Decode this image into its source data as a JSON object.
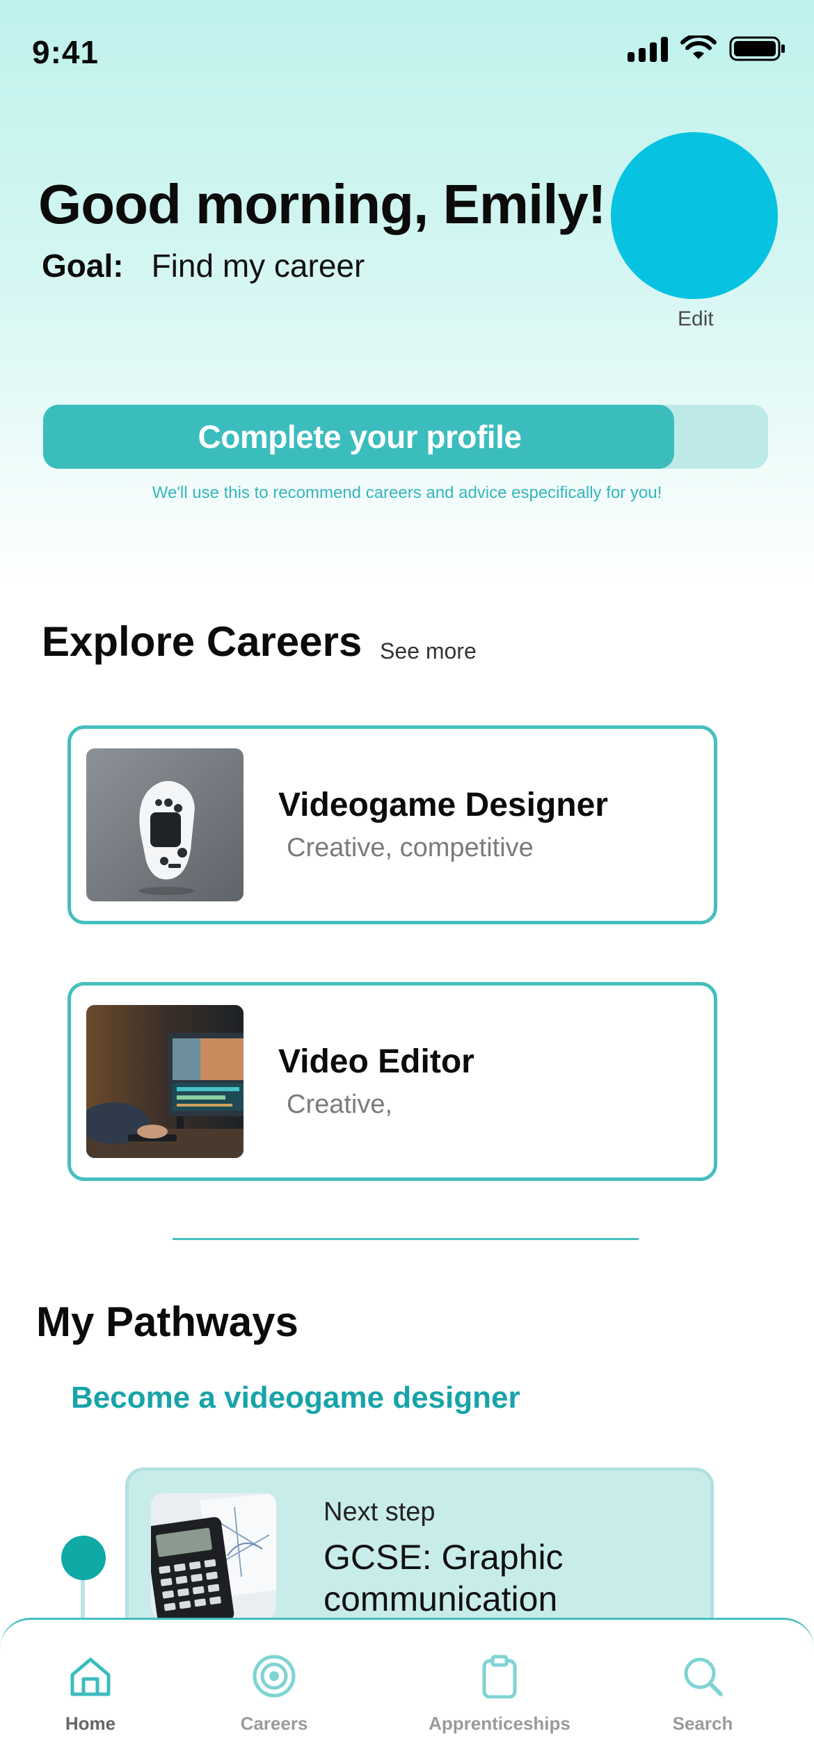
{
  "status_bar": {
    "time": "9:41"
  },
  "header": {
    "greeting": "Good morning, Emily!",
    "goal_label": "Goal:",
    "goal_value": "Find my career",
    "edit_label": "Edit",
    "avatar_color": "#08c2e1"
  },
  "profile": {
    "cta_label": "Complete your profile",
    "note": "We'll use this to recommend careers and advice especifically for you!",
    "completion_fraction": 0.87
  },
  "explore": {
    "title": "Explore Careers",
    "see_more": "See more",
    "careers": [
      {
        "title": "Videogame Designer",
        "tags": "Creative, competitive",
        "image": "game-controller"
      },
      {
        "title": "Video Editor",
        "tags": "Creative,",
        "image": "editing-workstation"
      }
    ]
  },
  "pathways": {
    "title": "My Pathways",
    "pathway_name": "Become a videogame designer",
    "next_step_label": "Next step",
    "next_step_title": "GCSE: Graphic communication",
    "next_step_image": "calculator-and-drawings"
  },
  "bottom_nav": {
    "items": [
      {
        "label": "Home",
        "icon": "home-icon",
        "active": true
      },
      {
        "label": "Careers",
        "icon": "target-icon",
        "active": false
      },
      {
        "label": "Apprenticeships",
        "icon": "clipboard-icon",
        "active": false
      },
      {
        "label": "Search",
        "icon": "search-icon",
        "active": false
      }
    ]
  },
  "colors": {
    "accent": "#45bfc0",
    "accent_dark": "#17a3a9",
    "progress_fill": "#3bbdbe",
    "progress_track": "#bdeae6"
  }
}
